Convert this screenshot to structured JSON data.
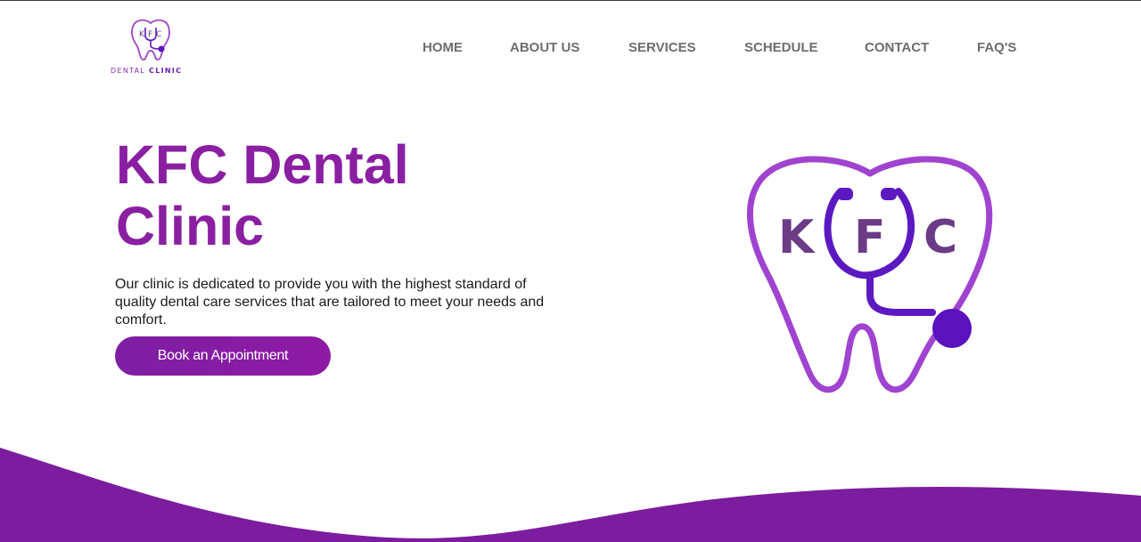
{
  "brand": {
    "logo_letters": "KFC",
    "logo_word1": "DENTAL",
    "logo_word2": "CLINIC"
  },
  "nav": {
    "items": [
      {
        "label": "HOME"
      },
      {
        "label": "ABOUT US"
      },
      {
        "label": "SERVICES"
      },
      {
        "label": "SCHEDULE"
      },
      {
        "label": "CONTACT"
      },
      {
        "label": "FAQ'S"
      }
    ]
  },
  "hero": {
    "title_line1": "KFC Dental",
    "title_line2": "Clinic",
    "description": "Our clinic is dedicated to provide you with the highest standard of quality dental care services that are tailored to meet your needs and comfort.",
    "cta_label": "Book an Appointment",
    "logo_letters": {
      "k": "K",
      "f": "F",
      "c": "C"
    }
  },
  "colors": {
    "brand_purple": "#8a1fa2",
    "deep_violet": "#5a16c0",
    "wave_purple": "#7b1d9e",
    "nav_gray": "#6d6d6d"
  }
}
